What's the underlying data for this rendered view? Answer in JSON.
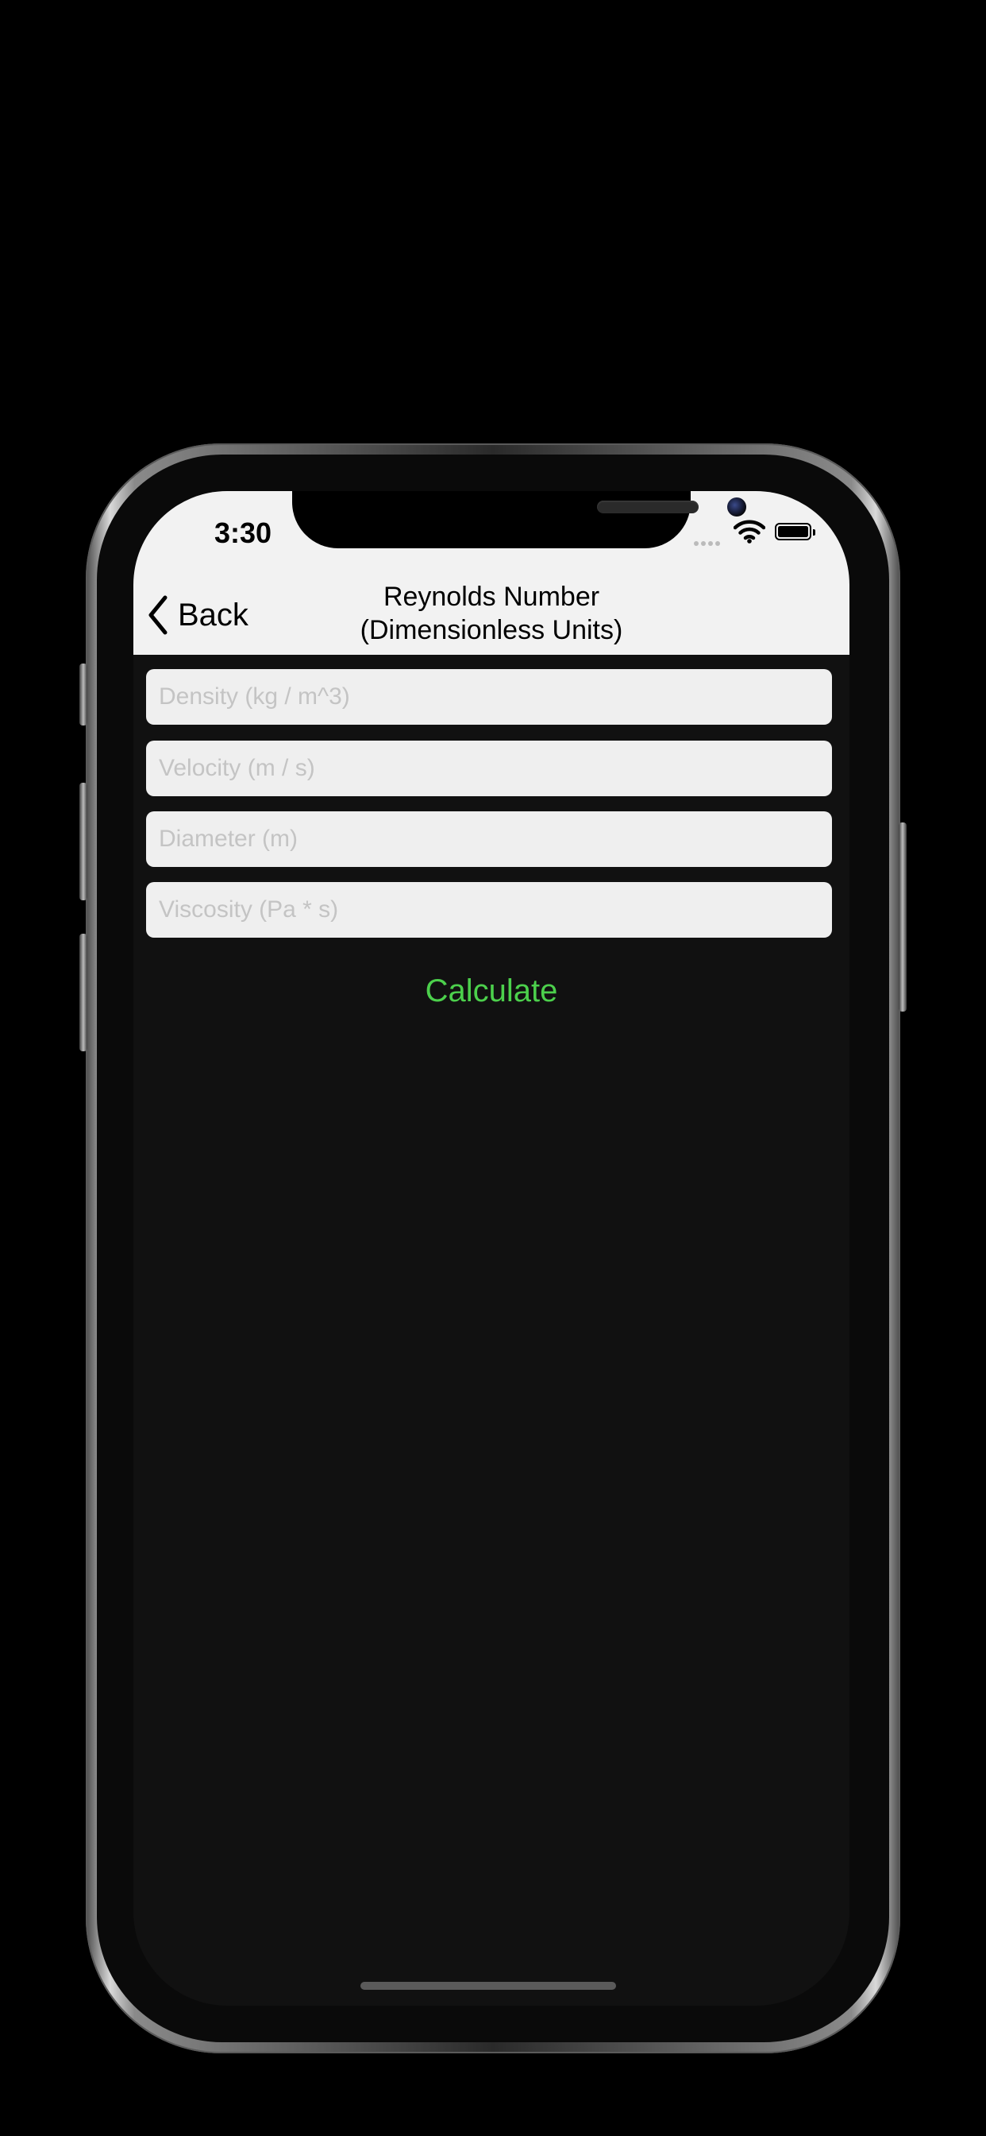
{
  "status_bar": {
    "time": "3:30",
    "icons": [
      "cellular-signal-icon",
      "wifi-icon",
      "battery-icon"
    ]
  },
  "nav": {
    "back_label": "Back",
    "title_line1": "Reynolds Number",
    "title_line2": "(Dimensionless Units)"
  },
  "fields": {
    "density": {
      "placeholder": "Density (kg / m^3)",
      "value": ""
    },
    "velocity": {
      "placeholder": "Velocity (m / s)",
      "value": ""
    },
    "diameter": {
      "placeholder": "Diameter (m)",
      "value": ""
    },
    "viscosity": {
      "placeholder": "Viscosity (Pa * s)",
      "value": ""
    }
  },
  "actions": {
    "calculate_label": "Calculate"
  },
  "colors": {
    "accent": "#4cd04c",
    "header_background": "#f2f2f2",
    "screen_background": "#111111",
    "field_background": "#efefef",
    "placeholder": "#c4c4c4"
  }
}
